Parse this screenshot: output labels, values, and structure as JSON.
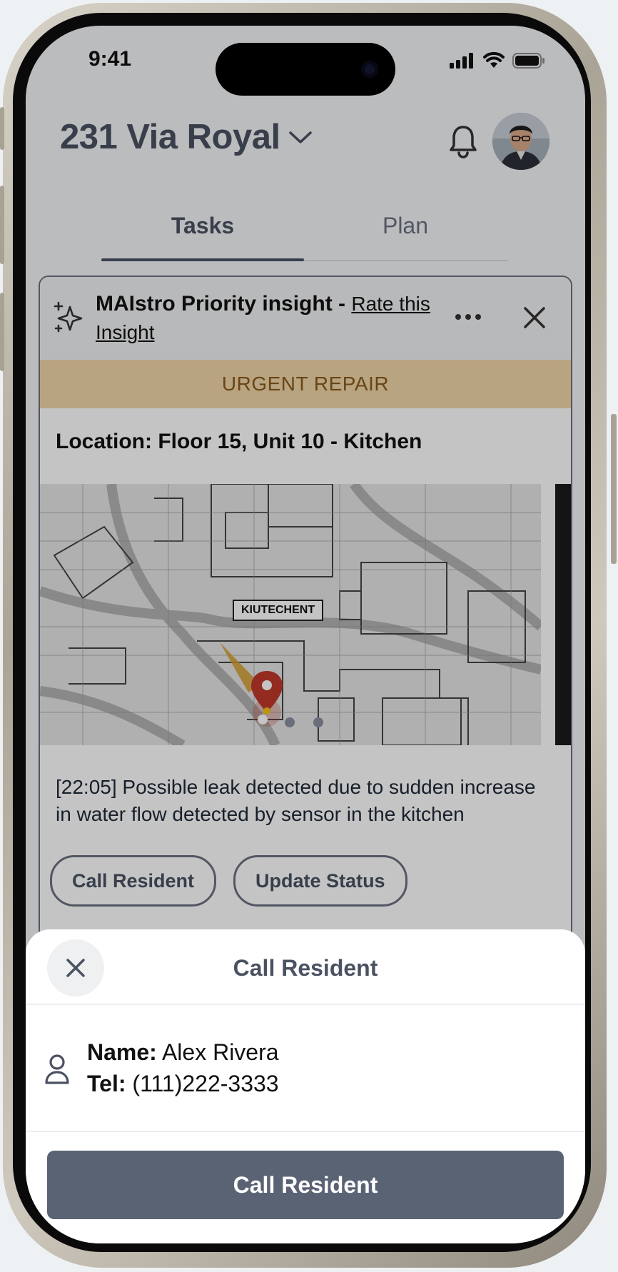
{
  "status_bar": {
    "time": "9:41"
  },
  "header": {
    "property_name": "231 Via Royal",
    "icons": [
      "chevron-down-icon",
      "bell-icon",
      "avatar"
    ]
  },
  "tabs": [
    {
      "label": "Tasks",
      "active": true
    },
    {
      "label": "Plan",
      "active": false
    }
  ],
  "insight": {
    "title": "MAIstro Priority insight - ",
    "rate_link": "Rate this Insight",
    "badge": "URGENT REPAIR",
    "location": "Location: Floor 15, Unit 10 - Kitchen",
    "map_label": "KIUTECHENT",
    "description": "[22:05] Possible leak detected due to sudden increase in water flow detected by sensor in the kitchen",
    "actions": [
      "Call Resident",
      "Update Status"
    ]
  },
  "sheet": {
    "title": "Call Resident",
    "name_label": "Name:",
    "name_value": "Alex Rivera",
    "tel_label": "Tel:",
    "tel_value": "(111)222-3333",
    "cta": "Call Resident"
  },
  "colors": {
    "urgent_bg": "#f0d6a8",
    "urgent_text": "#8a5a1c",
    "primary_button": "#5a6374",
    "title_text": "#4a5262"
  }
}
